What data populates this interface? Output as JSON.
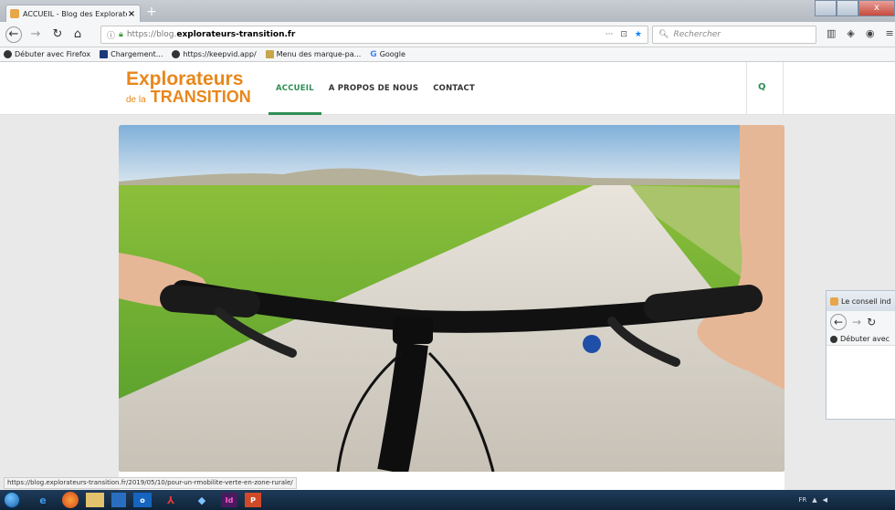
{
  "browser": {
    "tab_title": "ACCUEIL - Blog des Explorateu",
    "new_tab": "+",
    "url_proto": "https://blog.",
    "url_host": "explorateurs-transition.fr",
    "url_more": "···",
    "search_placeholder": "Rechercher",
    "bookmarks": [
      {
        "label": "Débuter avec Firefox"
      },
      {
        "label": "Chargement..."
      },
      {
        "label": "https://keepvid.app/"
      },
      {
        "label": "Menu des marque-pa..."
      },
      {
        "label": "Google"
      }
    ]
  },
  "site": {
    "logo_line1": "Explorateurs",
    "logo_de_la": "de la",
    "logo_line2": "TRANSITION",
    "menu": [
      {
        "label": "ACCUEIL"
      },
      {
        "label": "A PROPOS DE NOUS"
      },
      {
        "label": "CONTACT"
      }
    ],
    "search_icon": "Q"
  },
  "status_link": "https://blog.explorateurs-transition.fr/2019/05/10/pour-un-rmobilite-verte-en-zone-rurale/",
  "second_window": {
    "tab_title": "Le conseil ind",
    "bookmark": "Débuter avec"
  },
  "tray": {
    "lang": "FR"
  },
  "colors": {
    "accent": "#2f8e55",
    "logo": "#e8871c"
  }
}
